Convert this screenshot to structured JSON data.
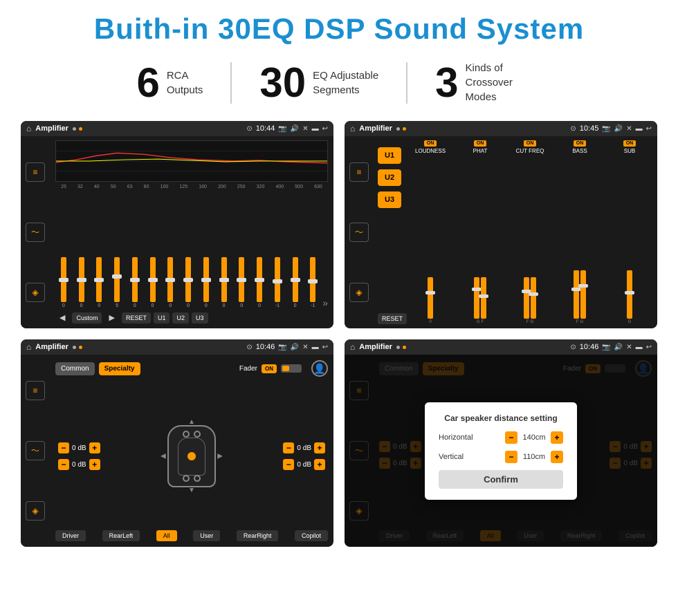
{
  "page": {
    "title": "Buith-in 30EQ DSP Sound System",
    "stats": [
      {
        "number": "6",
        "desc_line1": "RCA",
        "desc_line2": "Outputs"
      },
      {
        "number": "30",
        "desc_line1": "EQ Adjustable",
        "desc_line2": "Segments"
      },
      {
        "number": "3",
        "desc_line1": "Kinds of",
        "desc_line2": "Crossover Modes"
      }
    ]
  },
  "screen1": {
    "title": "Amplifier",
    "time": "10:44",
    "mode": "Custom",
    "freq_labels": [
      "25",
      "32",
      "40",
      "50",
      "63",
      "80",
      "100",
      "125",
      "160",
      "200",
      "250",
      "320",
      "400",
      "500",
      "630"
    ],
    "slider_vals": [
      "0",
      "0",
      "0",
      "5",
      "0",
      "0",
      "0",
      "0",
      "0",
      "0",
      "0",
      "0",
      "-1",
      "0",
      "-1"
    ],
    "buttons": [
      "Custom",
      "RESET",
      "U1",
      "U2",
      "U3"
    ]
  },
  "screen2": {
    "title": "Amplifier",
    "time": "10:45",
    "u_buttons": [
      "U1",
      "U2",
      "U3"
    ],
    "reset_label": "RESET",
    "channels": [
      {
        "on": true,
        "label": "LOUDNESS"
      },
      {
        "on": true,
        "label": "PHAT"
      },
      {
        "on": true,
        "label": "CUT FREQ"
      },
      {
        "on": true,
        "label": "BASS"
      },
      {
        "on": true,
        "label": "SUB"
      }
    ]
  },
  "screen3": {
    "title": "Amplifier",
    "time": "10:46",
    "tabs": [
      "Common",
      "Specialty"
    ],
    "active_tab": "Specialty",
    "fader_label": "Fader",
    "on_label": "ON",
    "db_controls": [
      {
        "label": "",
        "value": "0 dB"
      },
      {
        "label": "",
        "value": "0 dB"
      },
      {
        "label": "",
        "value": "0 dB"
      },
      {
        "label": "",
        "value": "0 dB"
      }
    ],
    "bottom_buttons": [
      "Driver",
      "RearLeft",
      "All",
      "User",
      "RearRight",
      "Copilot"
    ]
  },
  "screen4": {
    "title": "Amplifier",
    "time": "10:46",
    "tabs": [
      "Common",
      "Specialty"
    ],
    "dialog": {
      "title": "Car speaker distance setting",
      "horizontal_label": "Horizontal",
      "horizontal_value": "140cm",
      "vertical_label": "Vertical",
      "vertical_value": "110cm",
      "confirm_label": "Confirm"
    },
    "bottom_buttons": [
      "Driver",
      "RearLeft",
      "All",
      "User",
      "RearRight",
      "Copilot"
    ]
  },
  "icons": {
    "home": "⌂",
    "back": "↩",
    "settings": "⚙",
    "sound": "♪",
    "wave": "≋",
    "speaker": "◈",
    "arrows": "»",
    "play": "▶",
    "prev": "◀",
    "person": "👤",
    "pin": "⊙",
    "cam": "📷",
    "vol": "🔊",
    "x": "✕",
    "rect": "▬",
    "undo": "↺"
  }
}
